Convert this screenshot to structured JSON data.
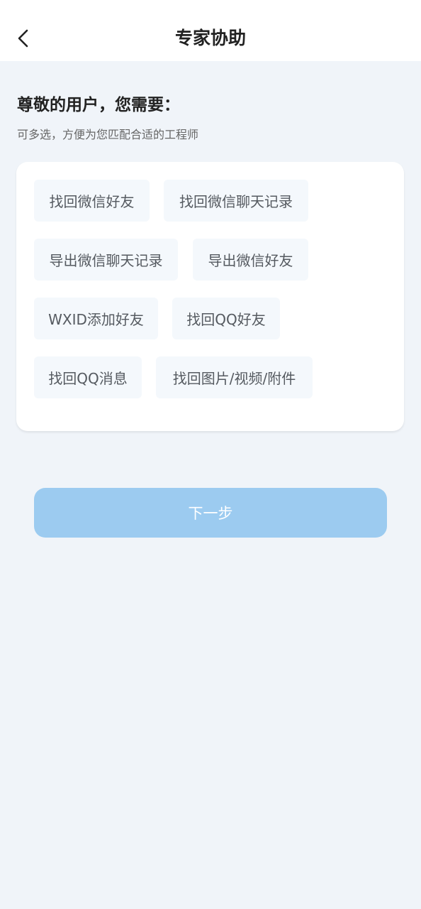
{
  "header": {
    "title": "专家协助",
    "back_icon": "chevron-left-icon"
  },
  "intro": {
    "heading": "尊敬的用户，您需要：",
    "subheading": "可多选，方便为您匹配合适的工程师"
  },
  "options": [
    "找回微信好友",
    "找回微信聊天记录",
    "导出微信聊天记录",
    "导出微信好友",
    "WXID添加好友",
    "找回QQ好友",
    "找回QQ消息",
    "找回图片/视频/附件"
  ],
  "next_button": {
    "label": "下一步",
    "color": "#9ccbf0"
  },
  "colors": {
    "background": "#f0f4f9",
    "card": "#ffffff",
    "chip": "#f4f8fc"
  }
}
